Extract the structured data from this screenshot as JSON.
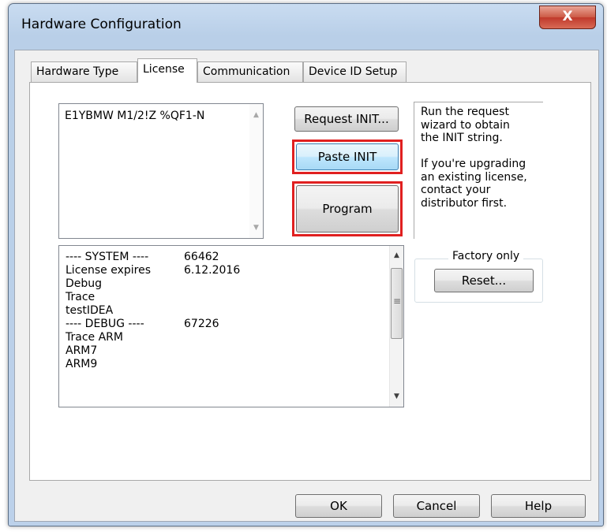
{
  "window": {
    "title": "Hardware Configuration",
    "close": "X"
  },
  "tabs": [
    "Hardware Type",
    "License",
    "Communication",
    "Device ID Setup"
  ],
  "init_box": {
    "text": "E1YBMW M1/2!Z %QF1-N"
  },
  "buttons": {
    "request_init": "Request INIT...",
    "paste_init": "Paste INIT",
    "program": "Program",
    "reset": "Reset...",
    "ok": "OK",
    "cancel": "Cancel",
    "help": "Help"
  },
  "info_text": [
    "Run the request",
    "wizard to obtain",
    "the INIT string.",
    "",
    "If you're upgrading",
    "an existing license,",
    "contact your",
    "distributor first."
  ],
  "factory_group": {
    "label": "Factory only"
  },
  "license_list": [
    {
      "name": "---- SYSTEM ----",
      "value": "66462"
    },
    {
      "name": "License expires",
      "value": "6.12.2016"
    },
    {
      "name": "Debug",
      "value": ""
    },
    {
      "name": "Trace",
      "value": ""
    },
    {
      "name": "testIDEA",
      "value": ""
    },
    {
      "name": "---- DEBUG ----",
      "value": "67226"
    },
    {
      "name": "Trace ARM",
      "value": ""
    },
    {
      "name": "ARM7",
      "value": ""
    },
    {
      "name": "ARM9",
      "value": ""
    }
  ],
  "icons": {
    "scroll_up": "▲",
    "scroll_down": "▼",
    "grip": "≡"
  }
}
